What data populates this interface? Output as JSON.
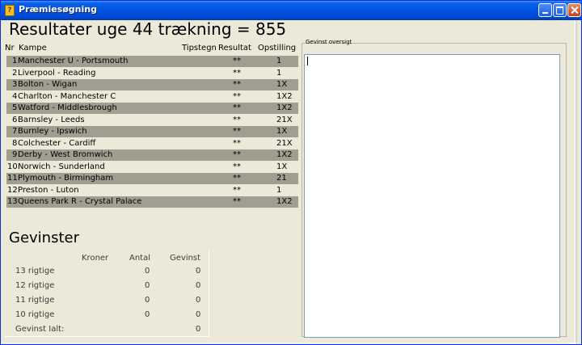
{
  "window": {
    "title": "Præmiesøgning"
  },
  "heading": "Resultater uge 44 trækning = 855",
  "results": {
    "headers": {
      "nr": "Nr",
      "kampe": "Kampe",
      "tipstegn": "Tipstegn",
      "resultat": "Resultat",
      "opstilling": "Opstilling"
    },
    "rows": [
      {
        "nr": "1",
        "match": "Manchester U - Portsmouth",
        "result": "**",
        "opstilling": "1"
      },
      {
        "nr": "2",
        "match": "Liverpool - Reading",
        "result": "**",
        "opstilling": "1"
      },
      {
        "nr": "3",
        "match": "Bolton - Wigan",
        "result": "**",
        "opstilling": "1X"
      },
      {
        "nr": "4",
        "match": "Charlton - Manchester C",
        "result": "**",
        "opstilling": "1X2"
      },
      {
        "nr": "5",
        "match": "Watford - Middlesbrough",
        "result": "**",
        "opstilling": "1X2"
      },
      {
        "nr": "6",
        "match": "Barnsley - Leeds",
        "result": "**",
        "opstilling": "21X"
      },
      {
        "nr": "7",
        "match": "Burnley - Ipswich",
        "result": "**",
        "opstilling": "1X"
      },
      {
        "nr": "8",
        "match": "Colchester - Cardiff",
        "result": "**",
        "opstilling": "21X"
      },
      {
        "nr": "9",
        "match": "Derby - West Bromwich",
        "result": "**",
        "opstilling": "1X2"
      },
      {
        "nr": "10",
        "match": "Norwich - Sunderland",
        "result": "**",
        "opstilling": "1X"
      },
      {
        "nr": "11",
        "match": "Plymouth - Birmingham",
        "result": "**",
        "opstilling": "21"
      },
      {
        "nr": "12",
        "match": "Preston - Luton",
        "result": "**",
        "opstilling": "1"
      },
      {
        "nr": "13",
        "match": "Queens Park R - Crystal Palace",
        "result": "**",
        "opstilling": "1X2"
      }
    ]
  },
  "prizes": {
    "title": "Gevinster",
    "headers": {
      "kroner": "Kroner",
      "antal": "Antal",
      "gevinst": "Gevinst"
    },
    "rows": [
      {
        "label": "13 rigtige",
        "kroner": "",
        "antal": "0",
        "gevinst": "0"
      },
      {
        "label": "12 rigtige",
        "kroner": "",
        "antal": "0",
        "gevinst": "0"
      },
      {
        "label": "11 rigtige",
        "kroner": "",
        "antal": "0",
        "gevinst": "0"
      },
      {
        "label": "10 rigtige",
        "kroner": "",
        "antal": "0",
        "gevinst": "0"
      }
    ],
    "total_label": "Gevinst Ialt:",
    "total_value": "0"
  },
  "overview": {
    "label": "Gevinst oversigt",
    "text": ""
  },
  "colors": {
    "titlebar": "#0054e3",
    "row_alt": "#a09d91",
    "window_bg": "#ece9d8"
  }
}
